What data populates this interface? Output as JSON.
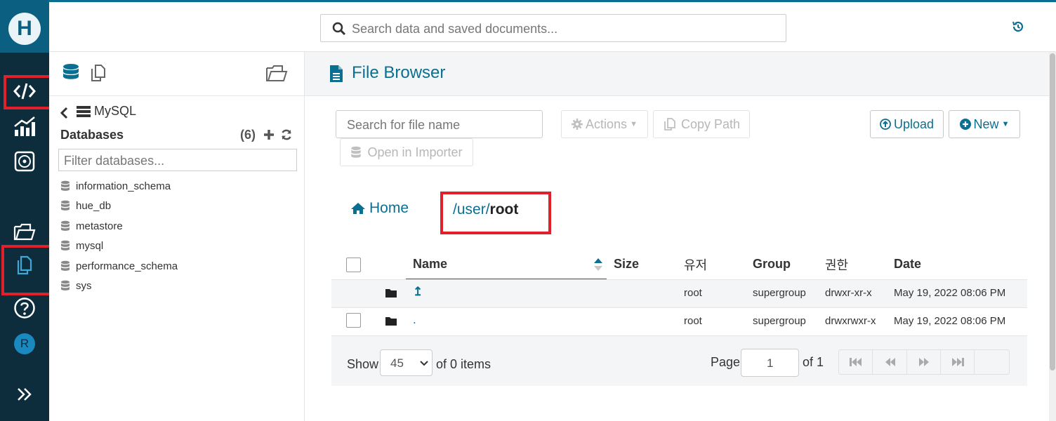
{
  "leftnav": {
    "logo_letter": "H",
    "avatar_letter": "R"
  },
  "topbar": {
    "search_placeholder": "Search data and saved documents..."
  },
  "assist": {
    "source_name": "MySQL",
    "databases_title": "Databases",
    "databases_count": "(6)",
    "filter_placeholder": "Filter databases...",
    "databases": [
      "information_schema",
      "hue_db",
      "metastore",
      "mysql",
      "performance_schema",
      "sys"
    ]
  },
  "main": {
    "title": "File Browser",
    "file_search_placeholder": "Search for file name",
    "actions_label": "Actions",
    "copy_path_label": "Copy Path",
    "upload_label": "Upload",
    "new_label": "New",
    "open_importer_label": "Open in Importer",
    "home_label": "Home",
    "path": {
      "sep1": "/",
      "part1": "user",
      "sep2": "/",
      "part2": "root"
    },
    "table": {
      "headers": {
        "name": "Name",
        "size": "Size",
        "user": "유저",
        "group": "Group",
        "perm": "권한",
        "date": "Date"
      },
      "rows": [
        {
          "name": "↥",
          "user": "root",
          "group": "supergroup",
          "perm": "drwxr-xr-x",
          "date": "May 19, 2022 08:06 PM"
        },
        {
          "name": ".",
          "user": "root",
          "group": "supergroup",
          "perm": "drwxrwxr-x",
          "date": "May 19, 2022 08:06 PM"
        }
      ]
    },
    "footer": {
      "show_label": "Show",
      "page_size": "45",
      "items_label": "of 0 items",
      "page_label": "Page",
      "page_value": "1",
      "of_pages": "of 1"
    }
  },
  "colors": {
    "accent": "#0b6f92",
    "nav_bg": "#0d2c3c",
    "highlight_box": "#e0212b"
  }
}
